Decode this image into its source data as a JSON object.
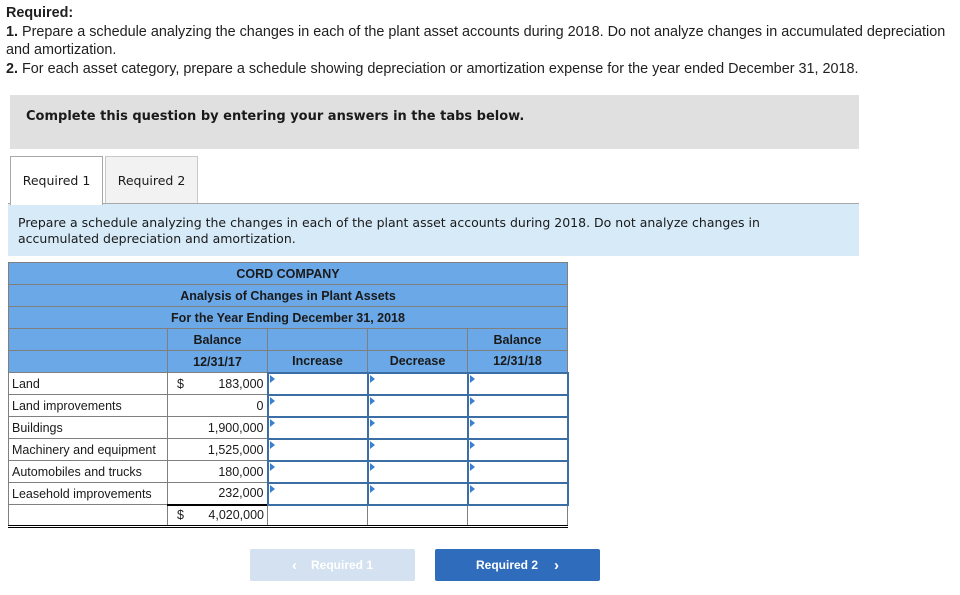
{
  "required": {
    "heading": "Required:",
    "items": [
      {
        "num": "1.",
        "text": " Prepare a schedule analyzing the changes in each of the plant asset accounts during 2018. Do not analyze changes in accumulated depreciation and amortization."
      },
      {
        "num": "2.",
        "text": " For each asset category, prepare a schedule showing depreciation or amortization expense for the year ended December 31, 2018."
      }
    ]
  },
  "banner": {
    "text": "Complete this question by entering your answers in the tabs below."
  },
  "tabs": [
    {
      "label": "Required 1",
      "active": true
    },
    {
      "label": "Required 2",
      "active": false
    }
  ],
  "instruction": "Prepare a schedule analyzing the changes in each of the plant asset accounts during 2018. Do not analyze changes in accumulated depreciation and amortization.",
  "schedule": {
    "company": "CORD COMPANY",
    "title": "Analysis of Changes in Plant Assets",
    "period": "For the Year Ending December 31, 2018",
    "headers": {
      "balance_start_1": "Balance",
      "balance_start_2": "12/31/17",
      "increase": "Increase",
      "decrease": "Decrease",
      "balance_end_1": "Balance",
      "balance_end_2": "12/31/18"
    },
    "rows": [
      {
        "label": "Land",
        "currency": "$",
        "balance": "183,000",
        "increase": "",
        "decrease": "",
        "ending": ""
      },
      {
        "label": "Land improvements",
        "currency": "",
        "balance": "0",
        "increase": "",
        "decrease": "",
        "ending": ""
      },
      {
        "label": "Buildings",
        "currency": "",
        "balance": "1,900,000",
        "increase": "",
        "decrease": "",
        "ending": ""
      },
      {
        "label": "Machinery and equipment",
        "currency": "",
        "balance": "1,525,000",
        "increase": "",
        "decrease": "",
        "ending": ""
      },
      {
        "label": "Automobiles and trucks",
        "currency": "",
        "balance": "180,000",
        "increase": "",
        "decrease": "",
        "ending": ""
      },
      {
        "label": "Leasehold improvements",
        "currency": "",
        "balance": "232,000",
        "increase": "",
        "decrease": "",
        "ending": ""
      }
    ],
    "total": {
      "label": "",
      "currency": "$",
      "balance": "4,020,000",
      "increase": "",
      "decrease": "",
      "ending": ""
    }
  },
  "nav": {
    "prev_label": "Required 1",
    "prev_icon": "chevron-left-icon",
    "prev_glyph": "‹",
    "next_label": "Required 2",
    "next_icon": "chevron-right-icon",
    "next_glyph": "›"
  }
}
